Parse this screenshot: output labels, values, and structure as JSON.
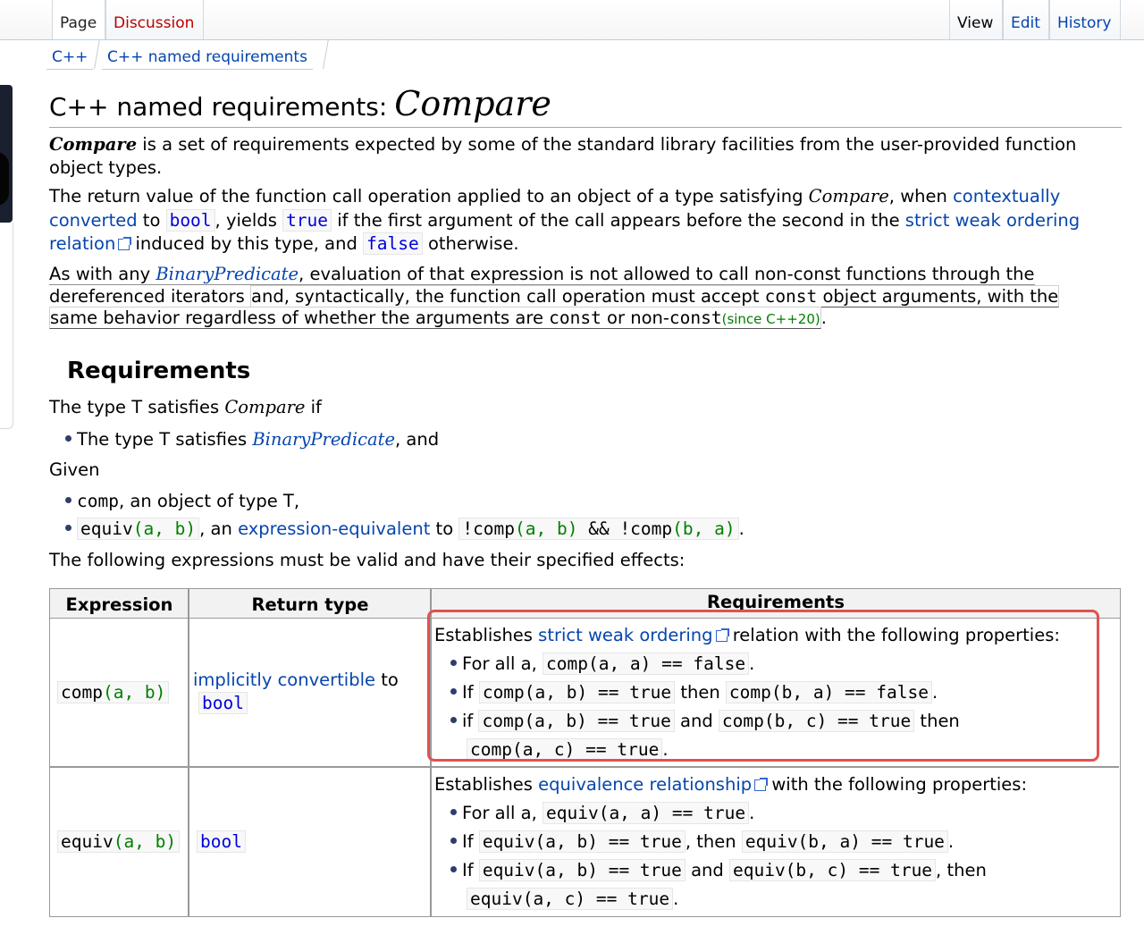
{
  "tabs": {
    "page": "Page",
    "discussion": "Discussion",
    "view": "View",
    "edit": "Edit",
    "history": "History"
  },
  "breadcrumb": [
    "C++",
    "C++ named requirements"
  ],
  "heading": {
    "prefix": "C++ named requirements:",
    "name": "Compare"
  },
  "intro": {
    "p1_name": "Compare",
    "p1_rest_a": " is a set of requirements expected by some of the standard library facilities from the user-provided function",
    "p1_rest_b": "object types.",
    "p2_a": "The return value of the function call operation applied to an object of a type satisfying ",
    "p2_name": "Compare",
    "p2_b": ", when ",
    "p2_link1": "contextually",
    "p2_link1b": "converted",
    "p2_c": " to ",
    "p2_bool": "bool",
    "p2_d": ", yields ",
    "p2_true": "true",
    "p2_e": " if the first argument of the call appears before the second in the ",
    "p2_link2": "strict weak ordering",
    "p2_link2b": "relation",
    "p2_f": " induced by this type, and ",
    "p2_false": "false",
    "p2_g": " otherwise.",
    "p3_a": "As with any ",
    "p3_link": "BinaryPredicate",
    "p3_b": ", evaluation of that expression is not allowed to call non-const functions through the",
    "p3_c": "dereferenced iterators",
    "p3_d": "and, syntactically, the function call operation must accept ",
    "p3_const1": "const",
    "p3_e": " object arguments, with the",
    "p3_f": "same behavior regardless of whether the arguments are ",
    "p3_const2": "const",
    "p3_g": " or non-",
    "p3_const3": "const",
    "p3_since": "(since C++20)",
    "p3_h": "."
  },
  "requirements": {
    "title": "Requirements",
    "line1_a": "The type T satisfies ",
    "line1_name": "Compare",
    "line1_b": " if",
    "bullet1_a": "The type T satisfies ",
    "bullet1_link": "BinaryPredicate",
    "bullet1_b": ", and",
    "given": "Given",
    "g1_code": "comp",
    "g1_rest": ", an object of type T,",
    "g2_code1": "equiv",
    "g2_code2": "(a, b)",
    "g2_a": ", an ",
    "g2_link": "expression-equivalent",
    "g2_b": " to ",
    "g2_code3": "!comp",
    "g2_code4": "(a, b)",
    "g2_code5": " && !comp",
    "g2_code6": "(b, a)",
    "g2_c": ".",
    "following": "The following expressions must be valid and have their specified effects:"
  },
  "table": {
    "headers": [
      "Expression",
      "Return type",
      "Requirements"
    ],
    "row1": {
      "expr_a": "comp",
      "expr_b": "(a, b)",
      "ret_link": "implicitly convertible",
      "ret_to": " to",
      "ret_type": "bool",
      "req_a": "Establishes ",
      "req_link": "strict weak ordering",
      "req_b": " relation with the following properties:",
      "b1_a": "For all a, ",
      "b1_code": "comp(a, a) == false",
      "b2_a": "If ",
      "b2_code1": "comp(a, b) == true",
      "b2_b": " then ",
      "b2_code2": "comp(b, a) == false",
      "b3_a": "if ",
      "b3_code1": "comp(a, b) == true",
      "b3_b": " and ",
      "b3_code2": "comp(b, c) == true",
      "b3_c": " then",
      "b3_code3": "comp(a, c) == true"
    },
    "row2": {
      "expr_a": "equiv",
      "expr_b": "(a, b)",
      "ret_type": "bool",
      "req_a": "Establishes ",
      "req_link": "equivalence relationship",
      "req_b": " with the following properties:",
      "b1_a": "For all a, ",
      "b1_code": "equiv(a, a) == true",
      "b2_a": "If ",
      "b2_code1": "equiv(a, b) == true",
      "b2_b": ", then ",
      "b2_code2": "equiv(b, a) == true",
      "b3_a": "If ",
      "b3_code1": "equiv(a, b) == true",
      "b3_b": " and ",
      "b3_code2": "equiv(b, c) == true",
      "b3_c": ", then",
      "b3_code3": "equiv(a, c) == true"
    }
  },
  "colors": {
    "link": "#0645ad",
    "keyword": "#0000dd",
    "paren": "#008000",
    "highlight": "#e05252"
  }
}
